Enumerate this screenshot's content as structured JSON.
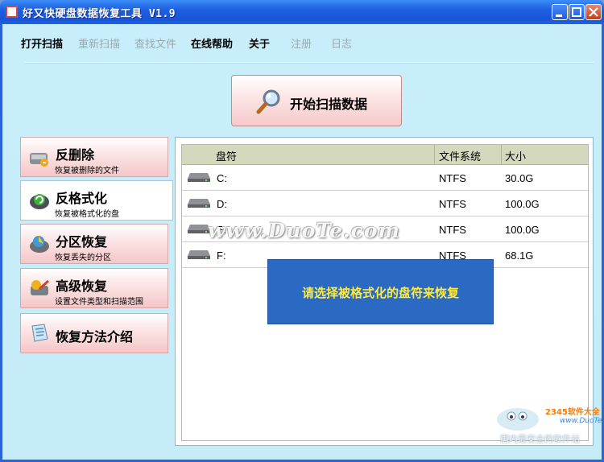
{
  "window": {
    "title": "好又快硬盘数据恢复工具 V1.9"
  },
  "menu": [
    {
      "label": "打开扫描",
      "enabled": true
    },
    {
      "label": "重新扫描",
      "enabled": false
    },
    {
      "label": "查找文件",
      "enabled": false
    },
    {
      "label": "在线帮助",
      "enabled": true
    },
    {
      "label": "关于",
      "enabled": true
    },
    {
      "label": "注册",
      "enabled": false
    },
    {
      "label": "日志",
      "enabled": false
    }
  ],
  "scan_button": {
    "label": "开始扫描数据",
    "icon": "magnifier-icon"
  },
  "sidebar": [
    {
      "title": "反删除",
      "subtitle": "恢复被删除的文件",
      "icon": "recycle-bin-icon",
      "active": false
    },
    {
      "title": "反格式化",
      "subtitle": "恢复被格式化的盘",
      "icon": "format-disk-icon",
      "active": true
    },
    {
      "title": "分区恢复",
      "subtitle": "恢复丢失的分区",
      "icon": "partition-disk-icon",
      "active": false
    },
    {
      "title": "高级恢复",
      "subtitle": "设置文件类型和扫描范围",
      "icon": "advanced-tools-icon",
      "active": false
    },
    {
      "title": "恢复方法介绍",
      "subtitle": "",
      "icon": "help-document-icon",
      "active": false
    }
  ],
  "table": {
    "headers": {
      "drive": "盘符",
      "fs": "文件系统",
      "size": "大小"
    },
    "rows": [
      {
        "drive": "C:",
        "fs": "NTFS",
        "size": "30.0G"
      },
      {
        "drive": "D:",
        "fs": "NTFS",
        "size": "100.0G"
      },
      {
        "drive": "E:",
        "fs": "NTFS",
        "size": "100.0G"
      },
      {
        "drive": "F:",
        "fs": "NTFS",
        "size": "68.1G"
      }
    ]
  },
  "notice": "请选择被格式化的盘符来恢复",
  "watermarks": {
    "center": "www.DuoTe.com",
    "brand": "2345软件大全",
    "site": "www.DuoTe.com",
    "slogan": "国内最安全的软件站"
  },
  "colors": {
    "titlebar": "#1d5fe0",
    "notice_bg": "#2b6ac3",
    "notice_text": "#ffeb3b",
    "window_bg": "#c9eefb"
  }
}
